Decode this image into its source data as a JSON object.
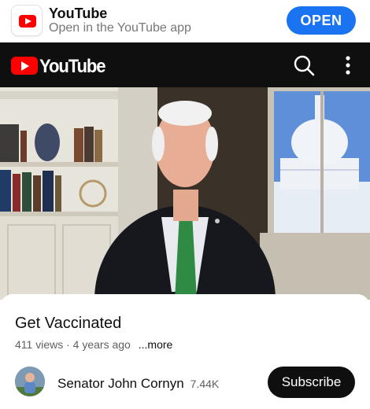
{
  "app_banner": {
    "app_name": "YouTube",
    "subtitle": "Open in the YouTube app",
    "open_label": "OPEN",
    "icon": "youtube-app-icon"
  },
  "header": {
    "logo_text": "YouTube",
    "icons": [
      "youtube-logo-icon",
      "search-icon",
      "more-vert-icon"
    ]
  },
  "video": {
    "thumbnail": "man-in-suit-speaking-capitol-dome-window"
  },
  "info": {
    "title": "Get Vaccinated",
    "views": "411 views",
    "separator": "·",
    "age": "4 years ago",
    "more_label": "...more"
  },
  "channel": {
    "name": "Senator John Cornyn",
    "subscribers": "7.44K",
    "subscribe_label": "Subscribe"
  },
  "colors": {
    "brand_red": "#ff0000",
    "open_blue": "#1a73f0",
    "header_bg": "#0f0f0f",
    "meta_gray": "#606060"
  }
}
